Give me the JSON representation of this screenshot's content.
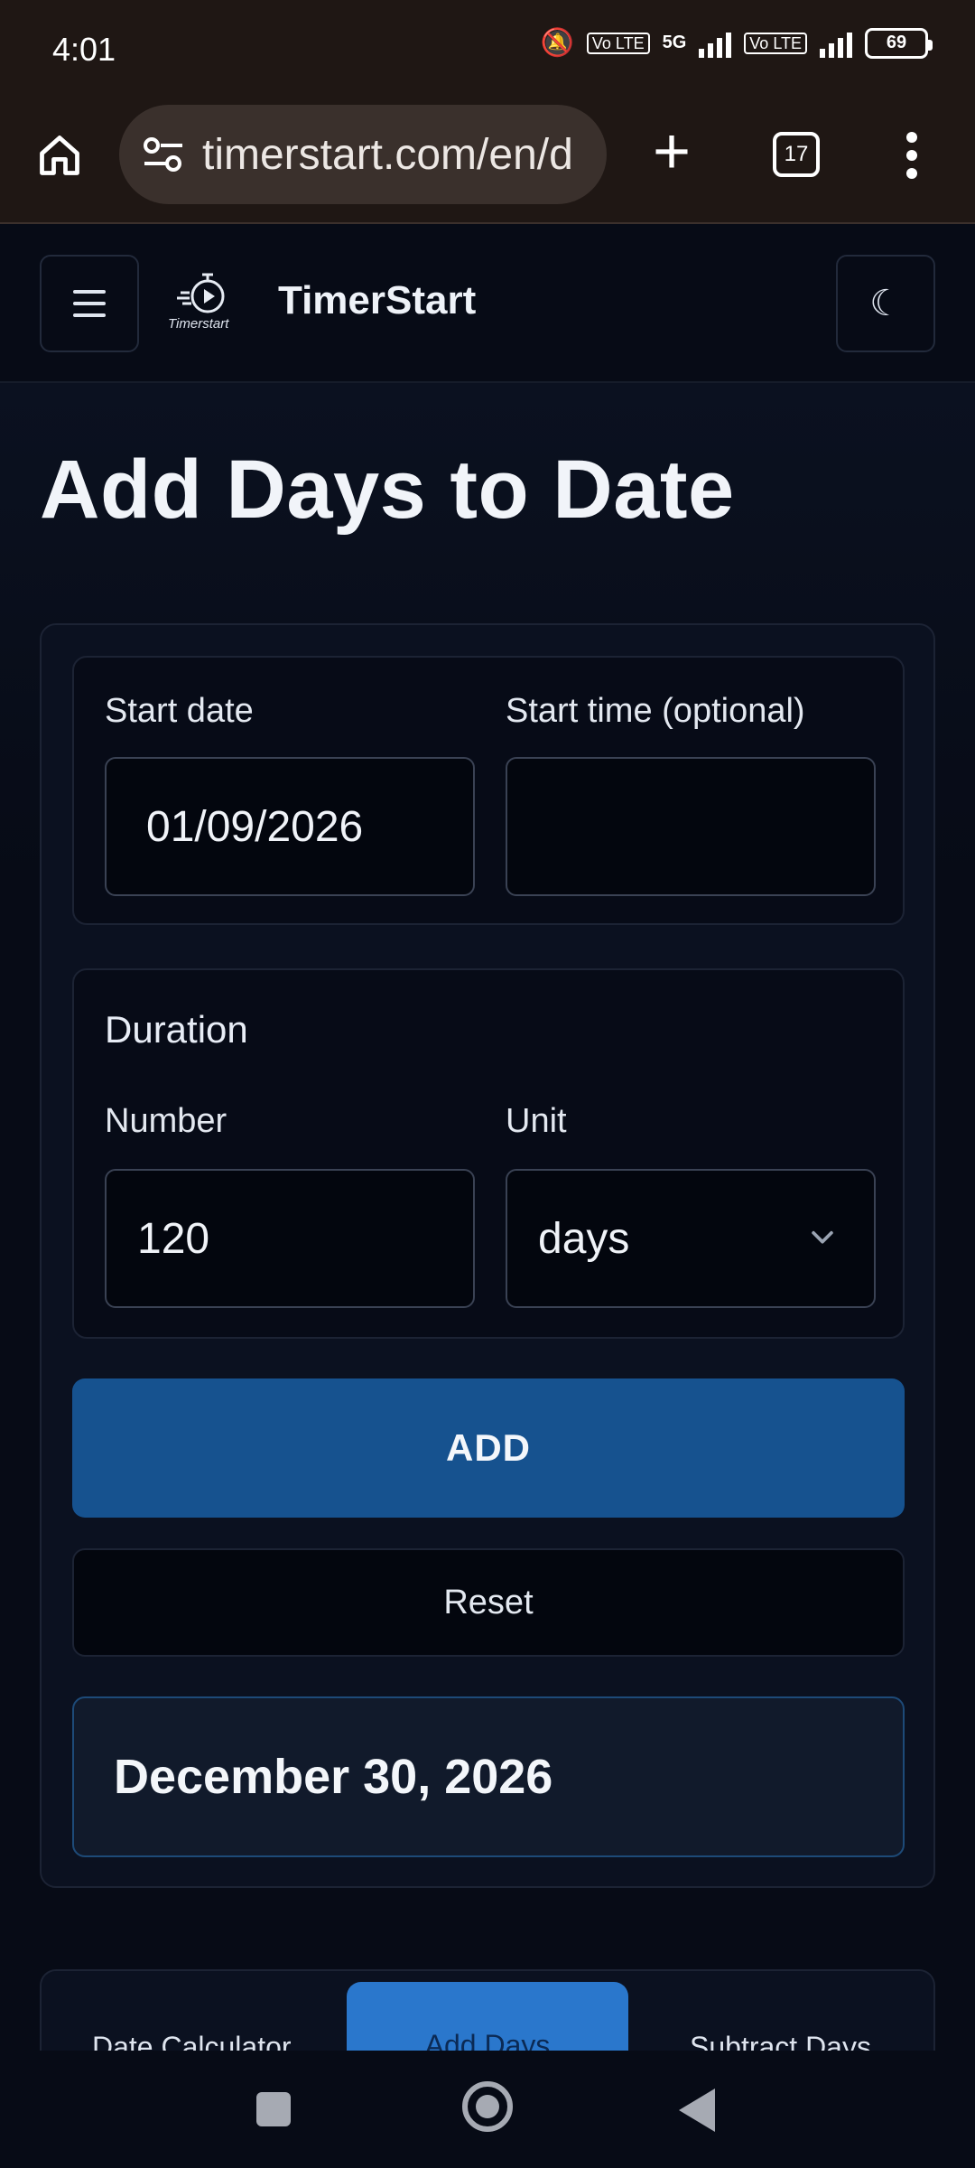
{
  "status_bar": {
    "time": "4:01",
    "network_badge_1": "Vo LTE",
    "network_label": "5G",
    "network_badge_2": "Vo LTE",
    "battery": "69"
  },
  "browser": {
    "url": "timerstart.com/en/d",
    "tab_count": "17",
    "icons": [
      "home-icon",
      "site-settings-icon",
      "new-tab-icon",
      "tab-switcher-icon",
      "overflow-menu-icon"
    ]
  },
  "header": {
    "site_title": "TimerStart",
    "logo_caption": "Timerstart",
    "theme_icon": "☾"
  },
  "page": {
    "title": "Add Days to Date"
  },
  "form": {
    "start_date_label": "Start date",
    "start_date_value": "01/09/2026",
    "start_time_label": "Start time (optional)",
    "start_time_value": "",
    "duration_title": "Duration",
    "number_label": "Number",
    "number_value": "120",
    "unit_label": "Unit",
    "unit_value": "days",
    "add_label": "ADD",
    "reset_label": "Reset",
    "result": "December 30, 2026"
  },
  "tabs": [
    {
      "label": "Date Calculator",
      "active": false
    },
    {
      "label": "Add Days",
      "active": true
    },
    {
      "label": "Subtract Days",
      "active": false
    }
  ],
  "colors": {
    "background": "#070b16",
    "accent": "#16528f",
    "active_tab": "#2a77cc",
    "browser_chrome": "#1f1714"
  }
}
